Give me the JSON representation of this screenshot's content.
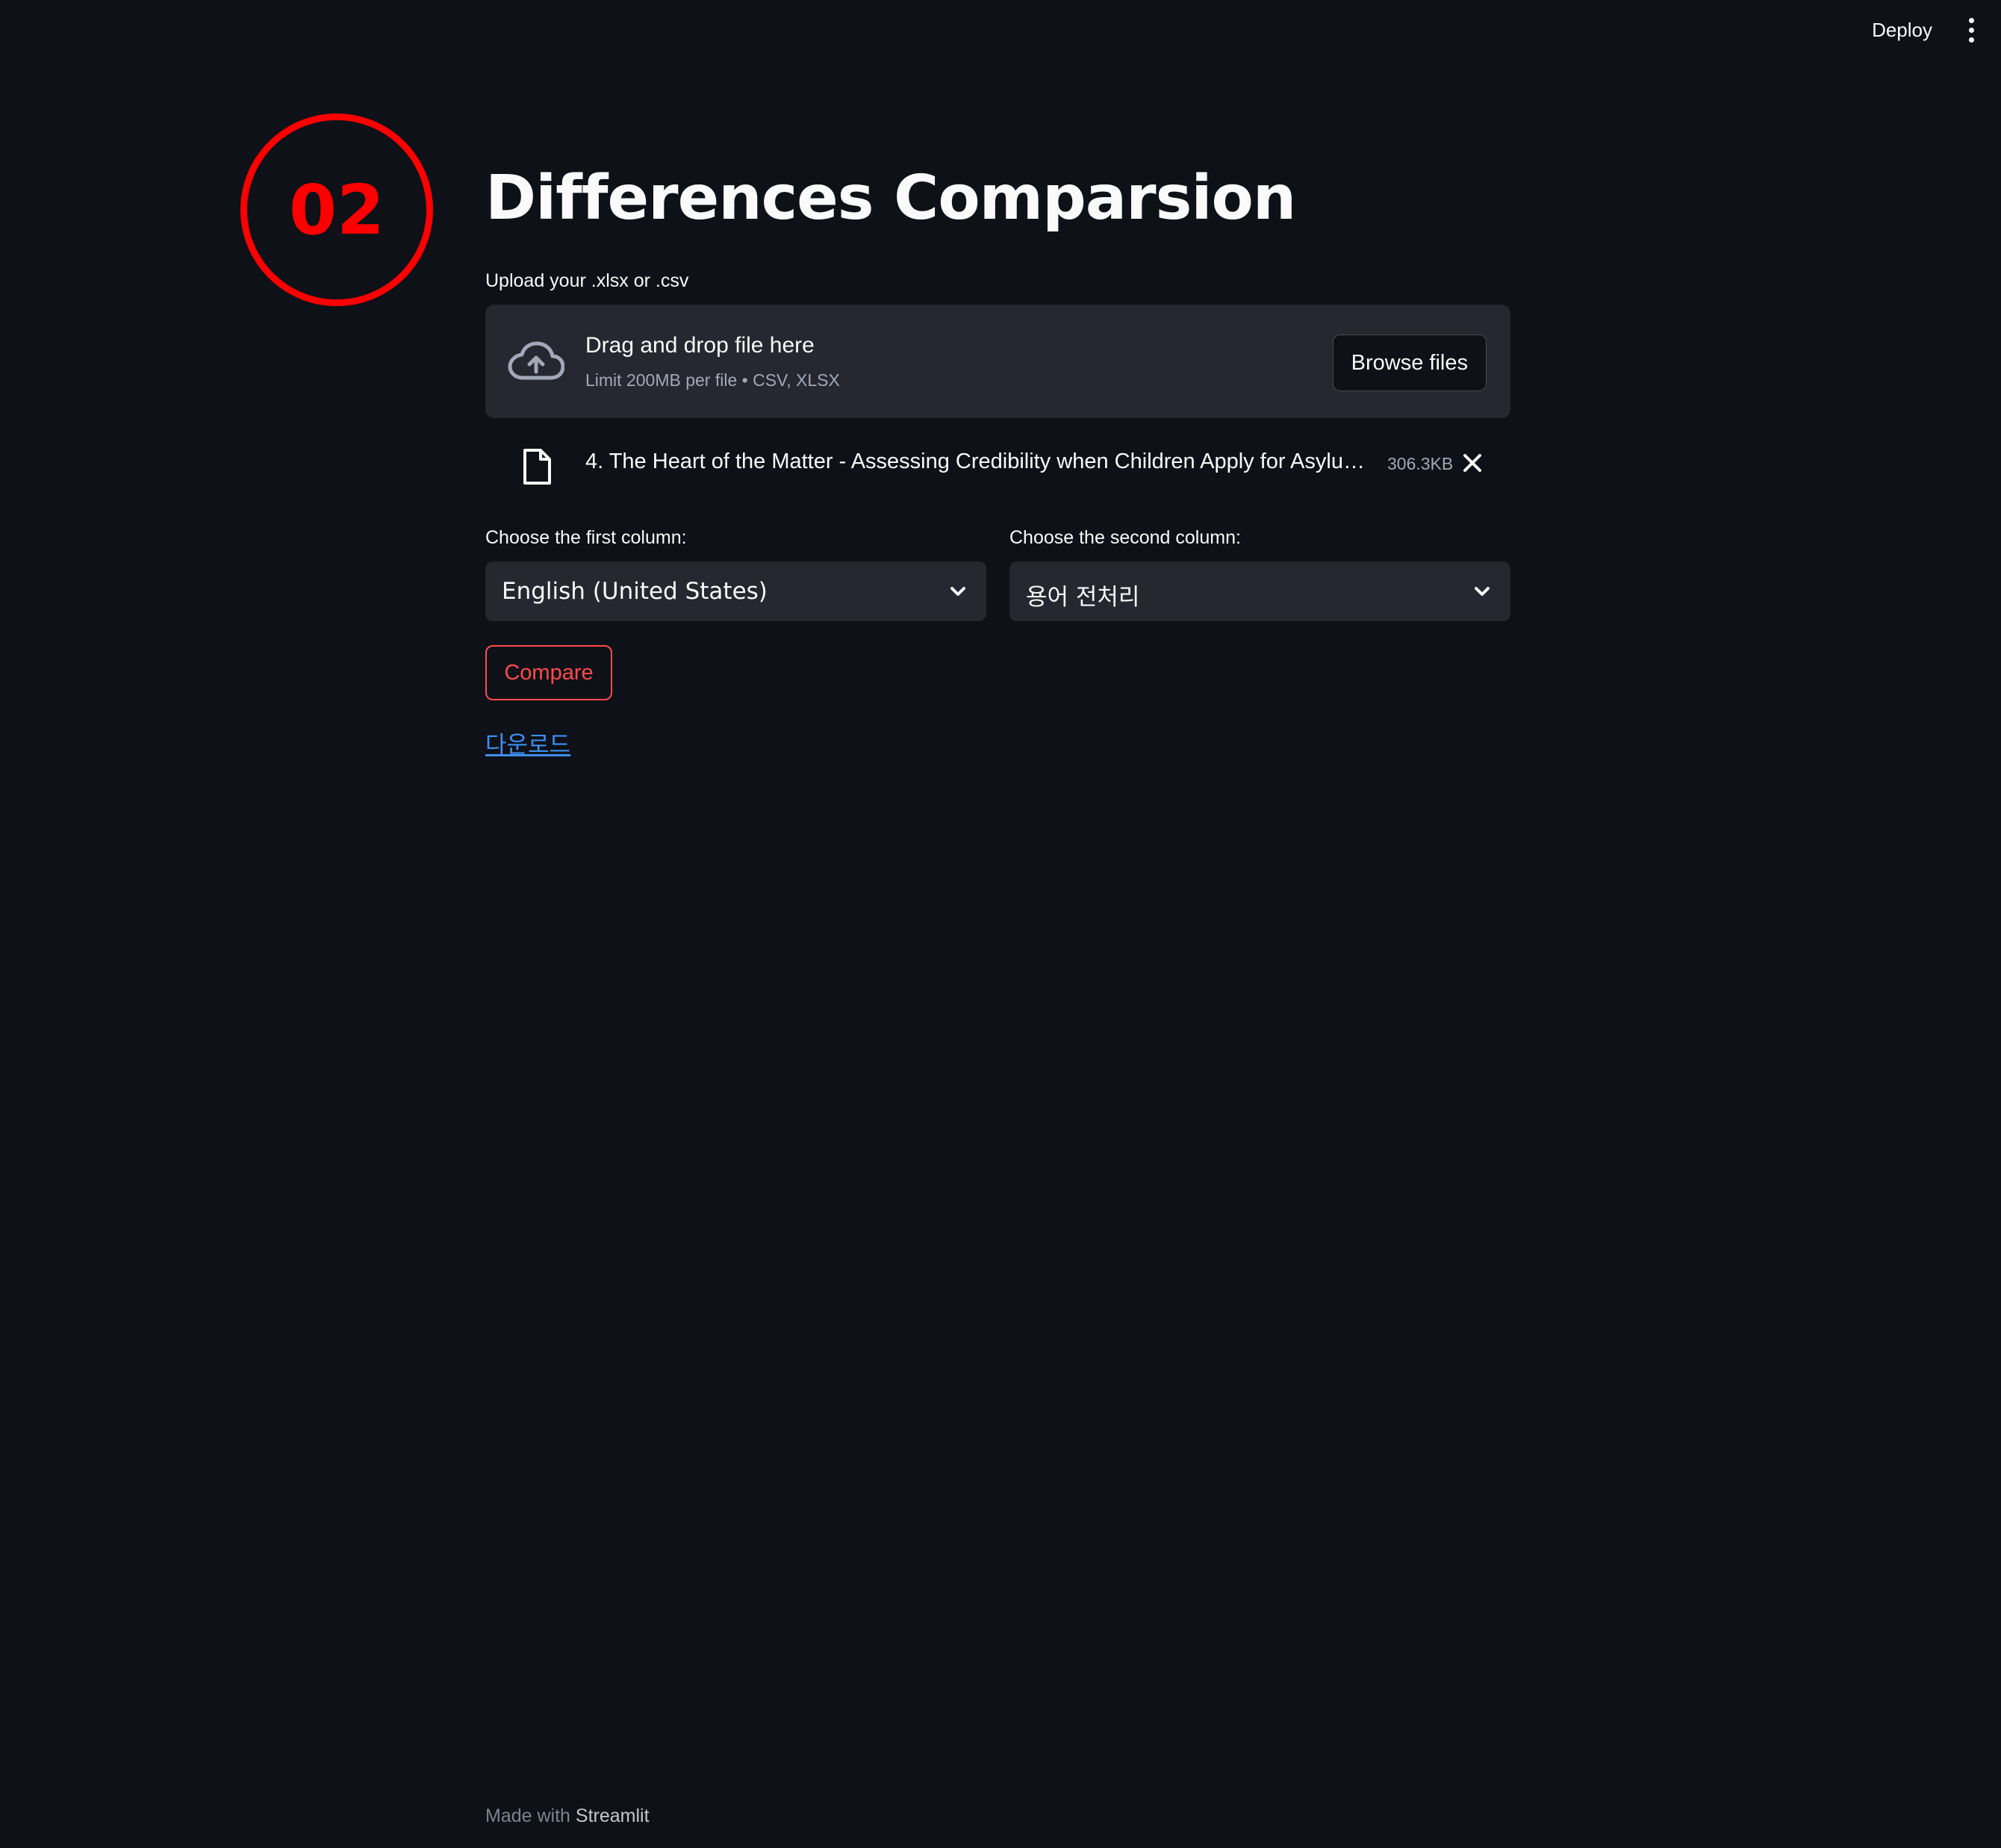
{
  "header": {
    "deploy_label": "Deploy",
    "menu_icon": "vertical-dots-icon"
  },
  "step_badge": {
    "number": "02",
    "color": "#ff0000"
  },
  "page": {
    "title": "Differences Comparsion"
  },
  "uploader": {
    "label": "Upload your .xlsx or .csv",
    "drop_title": "Drag and drop file here",
    "drop_subtitle": "Limit 200MB per file • CSV, XLSX",
    "browse_label": "Browse files",
    "icon": "cloud-upload-icon"
  },
  "uploaded_file": {
    "name": "4. The Heart of the Matter - Assessing Credibility when Children Apply for Asylu…",
    "size": "306.3KB",
    "icon": "file-icon",
    "remove_icon": "close-icon"
  },
  "selects": {
    "first": {
      "label": "Choose the first column:",
      "value": "English (United States)"
    },
    "second": {
      "label": "Choose the second column:",
      "value": "용어 전처리"
    }
  },
  "actions": {
    "compare_label": "Compare",
    "download_label": "다운로드"
  },
  "footer": {
    "prefix": "Made with",
    "brand": "Streamlit"
  },
  "colors": {
    "background": "#0e1117",
    "panel": "#262730",
    "accent": "#ff4b4b",
    "link": "#3d8ff0"
  }
}
